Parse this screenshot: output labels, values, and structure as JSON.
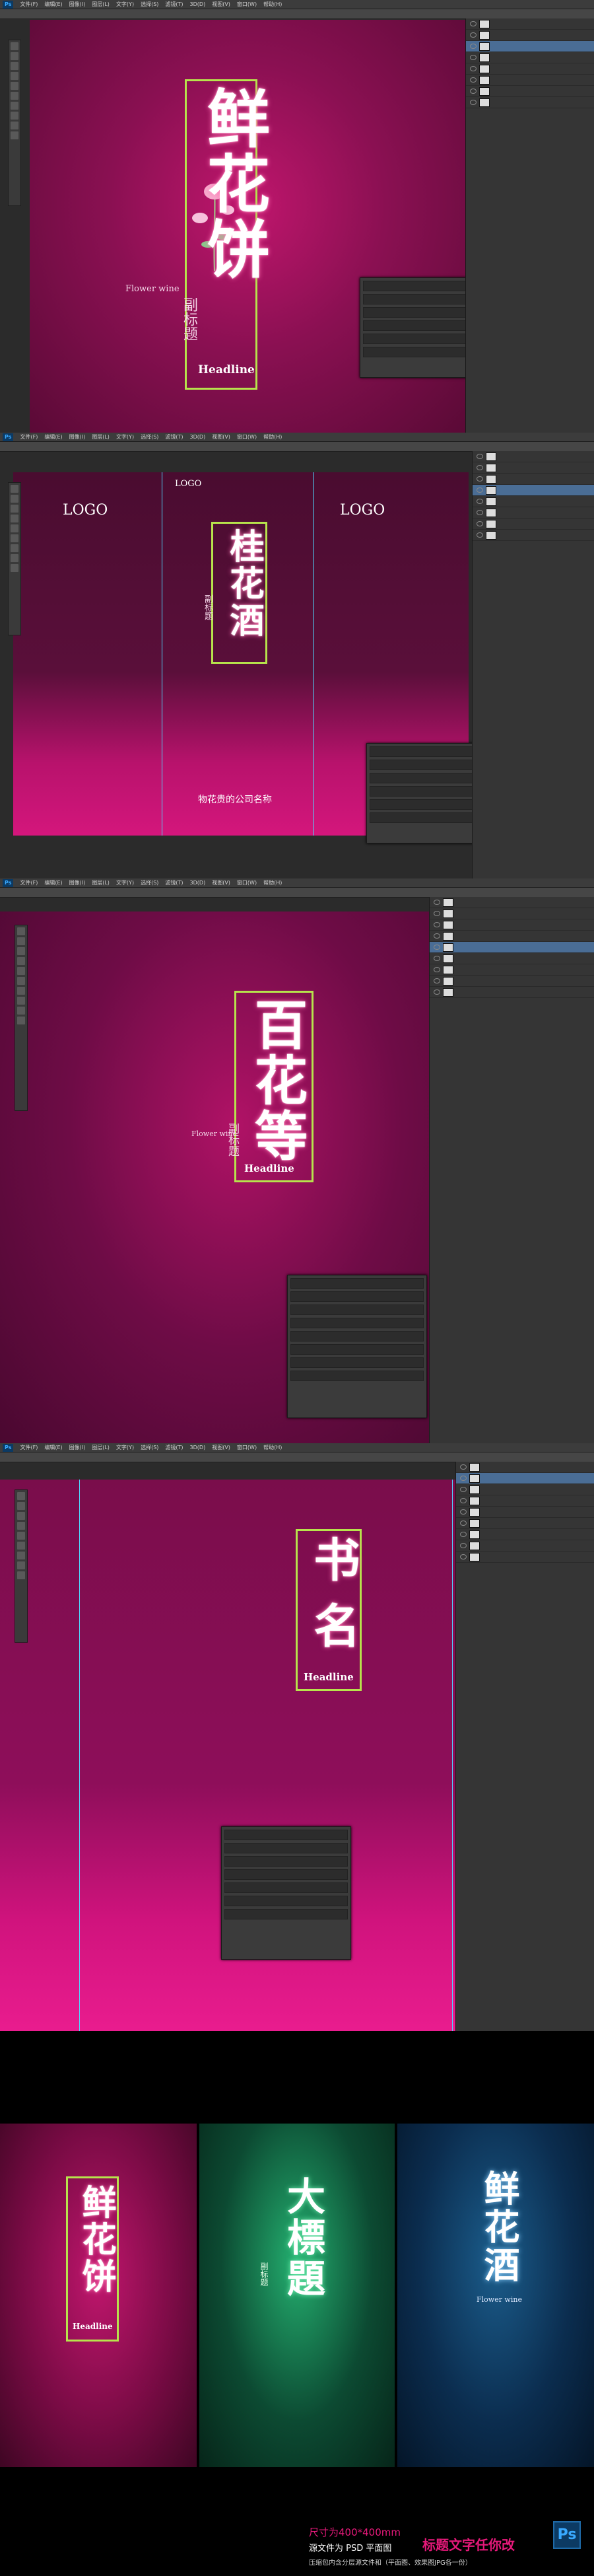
{
  "screens": [
    {
      "menu": [
        "Ps",
        "文件(F)",
        "编辑(E)",
        "图像(I)",
        "图层(L)",
        "文字(Y)",
        "选择(S)",
        "滤镜(T)",
        "3D(D)",
        "视图(V)",
        "窗口(W)",
        "帮助(H)"
      ],
      "title": "鲜花饼",
      "subtitle": "副标题",
      "english": "Flower wine",
      "headline": "Headline",
      "colors": {
        "bg": "#8a1052",
        "accent": "#b7e34c"
      }
    },
    {
      "menu": [
        "Ps",
        "文件(F)",
        "编辑(E)",
        "图像(I)",
        "图层(L)",
        "文字(Y)",
        "选择(S)",
        "滤镜(T)",
        "3D(D)",
        "视图(V)",
        "窗口(W)",
        "帮助(H)"
      ],
      "title": "桂花酒",
      "subtitle": "副标题",
      "logo1": "LOGO",
      "logo2": "LOGO",
      "logo3": "LOGO",
      "company": "物花贵的公司名称",
      "colors": {
        "bg": "#5a0f3a"
      }
    },
    {
      "menu": [
        "Ps",
        "文件(F)",
        "编辑(E)",
        "图像(I)",
        "图层(L)",
        "文字(Y)",
        "选择(S)",
        "滤镜(T)",
        "3D(D)",
        "视图(V)",
        "窗口(W)",
        "帮助(H)"
      ],
      "title": "百花等",
      "subtitle": "副标题",
      "english": "Flower wine",
      "headline": "Headline",
      "colors": {
        "bg": "#6e0c46"
      }
    },
    {
      "menu": [
        "Ps",
        "文件(F)",
        "编辑(E)",
        "图像(I)",
        "图层(L)",
        "文字(Y)",
        "选择(S)",
        "滤镜(T)",
        "3D(D)",
        "视图(V)",
        "窗口(W)",
        "帮助(H)"
      ],
      "title": "书名",
      "headline": "Headline",
      "colors": {
        "bg": "#8e0e5a"
      }
    }
  ],
  "gallery": [
    {
      "title": "鲜花饼",
      "headline": "Headline",
      "bg": "#7a0b45"
    },
    {
      "title": "大標題",
      "subtitle": "副标题",
      "bg": "#0c4a32"
    },
    {
      "title": "鲜花酒",
      "english": "Flower wine",
      "bg": "#0b2d4f"
    }
  ],
  "footer": {
    "size": "尺寸为400*400mm",
    "source": "源文件为 PSD 平面图",
    "note": "标题文字任你改",
    "bottom": "压缩包内含分层源文件和（平面图、效果图JPG各一份）",
    "ps_logo": "Ps"
  }
}
